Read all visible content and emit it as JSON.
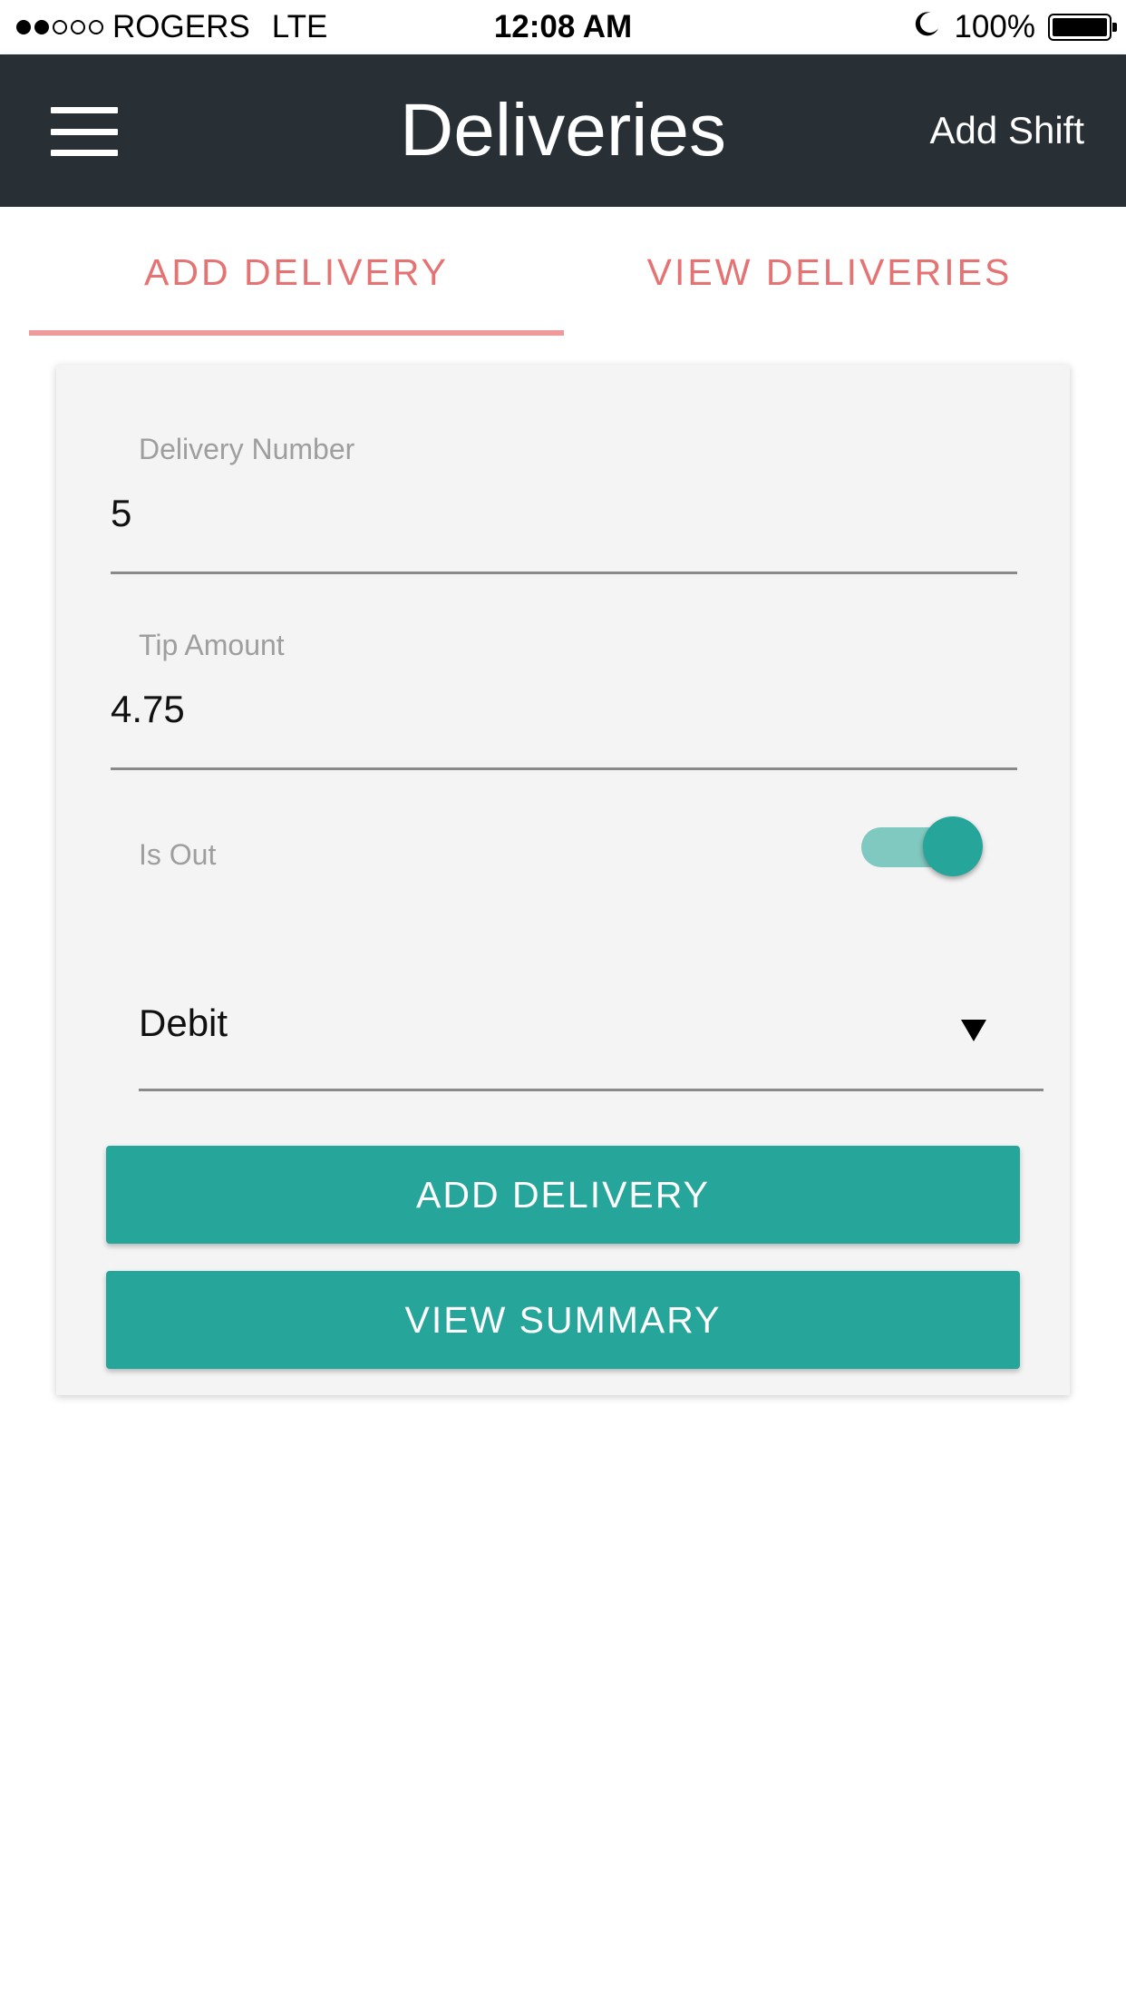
{
  "status_bar": {
    "signal_filled": 2,
    "signal_total": 5,
    "carrier": "ROGERS",
    "network": "LTE",
    "time": "12:08 AM",
    "battery_percent": "100%",
    "icons": [
      "moon-icon",
      "battery-icon"
    ]
  },
  "app_bar": {
    "title": "Deliveries",
    "action_label": "Add Shift",
    "menu_icon": "hamburger-menu-icon",
    "background_color": "#283036"
  },
  "tabs": [
    {
      "label": "ADD DELIVERY",
      "selected": true
    },
    {
      "label": "VIEW DELIVERIES",
      "selected": false
    }
  ],
  "form": {
    "delivery_number": {
      "label": "Delivery Number",
      "value": "5"
    },
    "tip_amount": {
      "label": "Tip Amount",
      "value": "4.75"
    },
    "is_out": {
      "label": "Is Out",
      "checked": true
    },
    "payment_type": {
      "value": "Debit"
    },
    "add_button": "ADD DELIVERY",
    "summary_button": "VIEW SUMMARY"
  },
  "colors": {
    "accent_teal": "#26a69a",
    "tab_text": "#e57373",
    "tab_indicator": "#ef9a9a"
  }
}
